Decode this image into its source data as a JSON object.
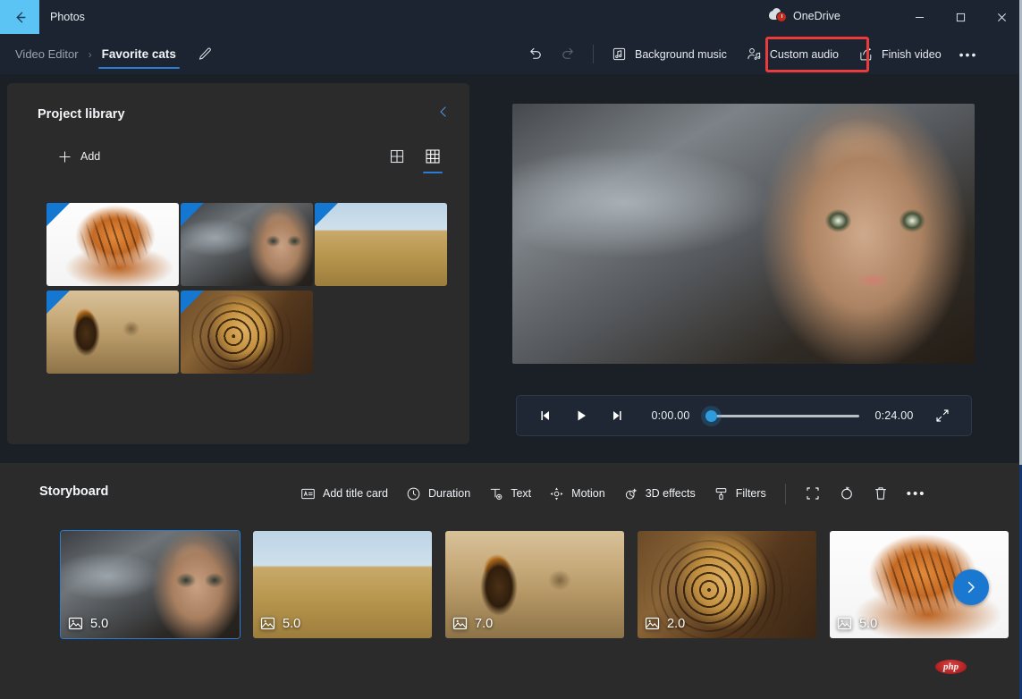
{
  "window": {
    "app_title": "Photos",
    "back_icon": "back-arrow-icon",
    "onedrive_label": "OneDrive",
    "minimize_label": "Minimize",
    "maximize_label": "Maximize",
    "close_label": "Close"
  },
  "breadcrumb": {
    "parent": "Video Editor",
    "separator": "›",
    "current": "Favorite cats",
    "rename_icon": "pencil-icon"
  },
  "toolbar": {
    "undo_label": "Undo",
    "redo_label": "Redo",
    "background_music": "Background music",
    "custom_audio": "Custom audio",
    "finish_video": "Finish video",
    "more_label": "•••",
    "highlight_color": "#ec3b3b",
    "highlighted_item": "Custom audio"
  },
  "library": {
    "title": "Project library",
    "collapse_icon": "chevron-left-icon",
    "add_label": "Add",
    "view_small_label": "Small grid view",
    "view_large_label": "Large grid view",
    "active_view": "large-grid",
    "items": [
      {
        "name": "tiger",
        "art": "art-tiger",
        "selected": true
      },
      {
        "name": "cougar",
        "art": "art-cougar",
        "selected": true
      },
      {
        "name": "cheetahs",
        "art": "art-cheetah",
        "selected": true
      },
      {
        "name": "lion",
        "art": "art-lion",
        "selected": true
      },
      {
        "name": "leopard",
        "art": "art-leopard",
        "selected": true
      }
    ]
  },
  "preview": {
    "current_frame": "cougar",
    "prev_frame_label": "Previous frame",
    "play_label": "Play",
    "next_frame_label": "Next frame",
    "current_time": "0:00.00",
    "total_time": "0:24.00",
    "progress_percent": 0,
    "fullscreen_label": "Full screen"
  },
  "storyboard": {
    "title": "Storyboard",
    "tools": [
      {
        "label": "Add title card",
        "icon": "title-card-icon"
      },
      {
        "label": "Duration",
        "icon": "clock-icon"
      },
      {
        "label": "Text",
        "icon": "text-icon"
      },
      {
        "label": "Motion",
        "icon": "motion-icon"
      },
      {
        "label": "3D effects",
        "icon": "sparkle-icon"
      },
      {
        "label": "Filters",
        "icon": "brush-icon"
      }
    ],
    "icon_tools": [
      {
        "label": "Crop",
        "icon": "crop-icon"
      },
      {
        "label": "Rotate",
        "icon": "rotate-icon"
      },
      {
        "label": "Delete",
        "icon": "trash-icon"
      },
      {
        "label": "See more",
        "icon": "ellipsis-icon"
      }
    ],
    "clips": [
      {
        "duration": "5.0",
        "art": "art-cougar",
        "name": "cougar",
        "selected": true
      },
      {
        "duration": "5.0",
        "art": "art-cheetah",
        "name": "cheetahs",
        "selected": false
      },
      {
        "duration": "7.0",
        "art": "art-lion",
        "name": "lion",
        "selected": false
      },
      {
        "duration": "2.0",
        "art": "art-leopard",
        "name": "leopard",
        "selected": false
      },
      {
        "duration": "5.0",
        "art": "art-tiger",
        "name": "tiger",
        "selected": false
      }
    ],
    "next_label": "Scroll right",
    "duration_icon": "image-icon"
  },
  "watermark": {
    "text": "php"
  },
  "colors": {
    "accent": "#1b78d0",
    "panel": "#2b2b2b",
    "titlebar": "#1b2430",
    "highlight": "#ec3b3b",
    "back_hover": "#5cc3f5"
  }
}
